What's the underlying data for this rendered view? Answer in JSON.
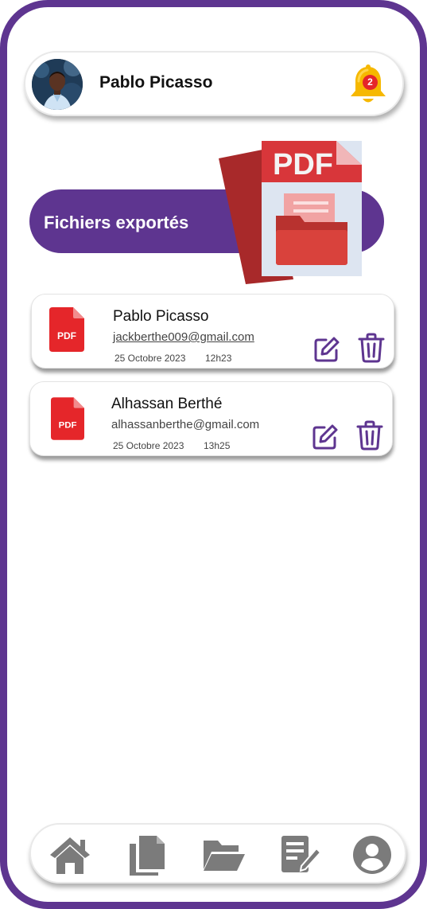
{
  "header": {
    "user_name": "Pablo Picasso",
    "notification_count": "2"
  },
  "banner": {
    "title": "Fichiers exportés",
    "pdf_label": "PDF"
  },
  "files": [
    {
      "icon_label": "PDF",
      "name": "Pablo Picasso",
      "email": "jackberthe009@gmail.com",
      "date": "25 Octobre 2023",
      "time": "12h23"
    },
    {
      "icon_label": "PDF",
      "name": "Alhassan Berthé",
      "email": "alhassanberthe@gmail.com",
      "date": "25 Octobre 2023",
      "time": "13h25"
    }
  ],
  "nav": {
    "items": [
      "home-icon",
      "documents-icon",
      "folder-icon",
      "edit-document-icon",
      "profile-icon"
    ]
  },
  "colors": {
    "primary": "#5e3590",
    "pdf_red": "#e5262a",
    "bell": "#f6b800",
    "nav_icon": "#7b7b7b"
  }
}
